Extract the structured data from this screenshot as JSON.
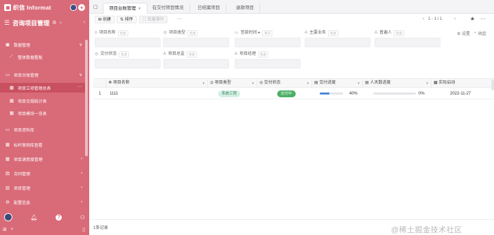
{
  "sidebar": {
    "brand": "织信 Informat",
    "app_title": "咨询项目管理",
    "items": [
      {
        "label": "数据管理",
        "icon": "box-icon",
        "chev": "∨"
      },
      {
        "label": "整体数据看板",
        "icon": "chart-line-icon",
        "chev": ""
      },
      {
        "label": "项目台账管理",
        "icon": "folder-icon",
        "chev": "∨"
      },
      {
        "label": "项目立项管理总表",
        "icon": "grid-icon",
        "chev": ""
      },
      {
        "label": "项目合规统计表",
        "icon": "grid-icon",
        "chev": ""
      },
      {
        "label": "项目模块一览表",
        "icon": "grid-icon",
        "chev": ""
      },
      {
        "label": "项目资料库",
        "icon": "folder-icon",
        "chev": ""
      },
      {
        "label": "标杆案例库查看",
        "icon": "grid-icon",
        "chev": ""
      },
      {
        "label": "项目满意度管理",
        "icon": "grid-icon",
        "chev": "›"
      },
      {
        "label": "合同管理",
        "icon": "file-icon",
        "chev": "›"
      },
      {
        "label": "项目管理",
        "icon": "briefcase-icon",
        "chev": "›"
      },
      {
        "label": "配置信息",
        "icon": "gear-icon",
        "chev": "›"
      }
    ]
  },
  "tabs": [
    {
      "label": "项目台账管理",
      "active": true
    },
    {
      "label": "在交付项目情况",
      "active": false
    },
    {
      "label": "已结案项目",
      "active": false
    },
    {
      "label": "退款项目",
      "active": false
    }
  ],
  "toolbar": {
    "create": "创建",
    "sort": "排序",
    "bulk": "批量操作",
    "more": "···",
    "pager": "1 - 1 / 1"
  },
  "filters": {
    "row1": [
      {
        "label": "项目名称",
        "hint": "包含",
        "icon": "≡"
      },
      {
        "label": "项目类型",
        "hint": "包含",
        "icon": "◎"
      },
      {
        "label": "签款时间 ▸",
        "hint": "等于",
        "icon": "▭"
      },
      {
        "label": "主要业务",
        "hint": "包含",
        "icon": "A"
      },
      {
        "label": "普遍人",
        "hint": "包含",
        "icon": "A"
      }
    ],
    "row2": [
      {
        "label": "交付状态",
        "hint": "包含",
        "icon": "◎"
      },
      {
        "label": "项目总监",
        "hint": "包含",
        "icon": "A"
      },
      {
        "label": "项目经理",
        "hint": "包含",
        "icon": "A"
      }
    ],
    "actions": {
      "settings": "设置",
      "toggle": "收起"
    }
  },
  "table": {
    "columns": [
      "项目名称",
      "项目类型",
      "交付状态",
      "交付进度",
      "人天数进度",
      "实际启动"
    ],
    "rows": [
      {
        "index": "1",
        "name": "1111",
        "type": "系统工程",
        "status": "交付中",
        "progress": "40%",
        "progress_value": 0.4,
        "days_progress": "0%",
        "days_value": 0.0,
        "start": "2022-11-27"
      }
    ]
  },
  "footer": {
    "count": "1条记录"
  },
  "watermark": "@稀土掘金技术社区",
  "colors": {
    "sidebar": "#d96a78",
    "accent": "#4c8ad6",
    "type_pill": "#d6efe4",
    "status_pill": "#4caf65"
  }
}
